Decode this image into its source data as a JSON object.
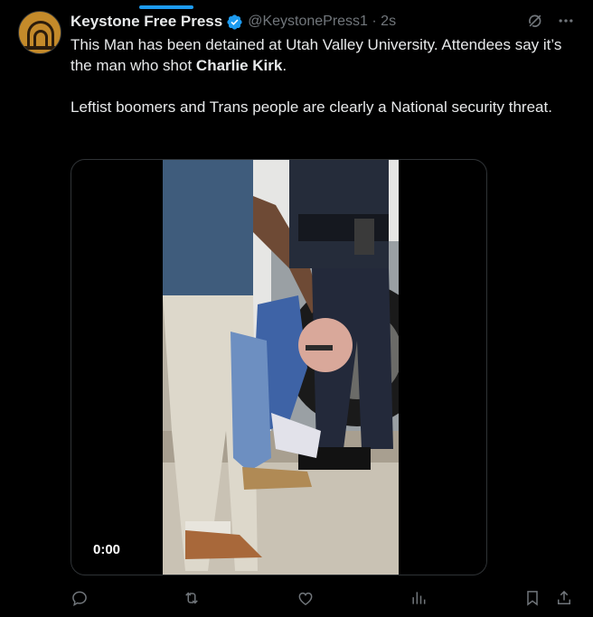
{
  "tweet": {
    "display_name": "Keystone Free Press",
    "handle_time": "@KeystonePress1 · 2s",
    "paragraph1_pre": "This Man has been detained at Utah Valley University. Attendees say it’s the man who shot ",
    "paragraph1_bold": "Charlie Kirk",
    "paragraph1_post": ".",
    "paragraph2": "Leftist boomers and Trans people are clearly a National security threat.",
    "video_time": "0:00"
  },
  "icons": {
    "verified": "verified-badge-icon",
    "grok": "grok-icon",
    "more": "more-icon",
    "reply": "reply-icon",
    "retweet": "retweet-icon",
    "like": "like-icon",
    "views": "views-icon",
    "bookmark": "bookmark-icon",
    "share": "share-icon"
  },
  "colors": {
    "background": "#000000",
    "text": "#e7e9ea",
    "secondary_text": "#71767b",
    "accent": "#1d9bf0",
    "border": "#2f3336"
  }
}
